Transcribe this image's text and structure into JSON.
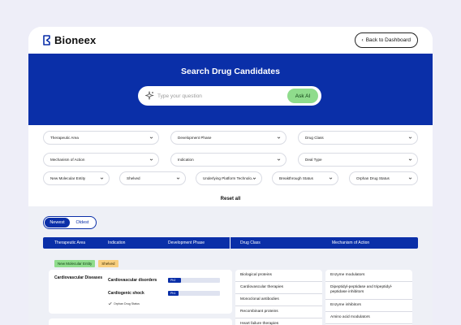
{
  "brand": {
    "name": "Bioneex"
  },
  "header": {
    "back_label": "Back to Dashboard"
  },
  "hero": {
    "title": "Search Drug Candidates"
  },
  "search": {
    "placeholder": "Type your question",
    "value": "",
    "ask_label": "Ask AI"
  },
  "filters": {
    "row1": [
      "Therapeutic Area",
      "Development Phase",
      "Drug Class"
    ],
    "row2": [
      "Mechanism of Action",
      "Indication",
      "Deal Type"
    ],
    "row3": [
      "New Molecular Entity",
      "Shelved",
      "Underlying Platform Technolo...",
      "Breakthrough Status",
      "Orphan Drug Status"
    ],
    "reset_label": "Reset all"
  },
  "sort": {
    "newest": "Newest",
    "oldest": "Oldest",
    "active": "Newest"
  },
  "table": {
    "columns": [
      "Therapeutic Area",
      "Indication",
      "Development Phase",
      "Drug Class",
      "Mechanism of Action"
    ]
  },
  "results": [
    {
      "tags": [
        "New Molecular Entity",
        "Shelved"
      ],
      "therapeutic_area": "Cardiovascular Diseases",
      "indications": [
        {
          "name": "Cardiovascular disorders",
          "phase": "Ph2",
          "progress": 0.25
        },
        {
          "name": "Cardiogenic shock",
          "phase": "Ph1",
          "progress": 0.2
        }
      ],
      "orphan_status": "Orphan Drug Status",
      "drug_classes": [
        "Biological proteins",
        "Cardiovascular therapies",
        "Monoclonal antibodies",
        "Recombinant proteins",
        "Heart failure therapies"
      ],
      "mechanisms": [
        "Enzyme modulators",
        "Dipeptidyl-peptidase and tripeptidyl-peptidase inhibitors",
        "Enzyme inhibitors",
        "Amino acid modulators"
      ]
    }
  ],
  "colors": {
    "primary": "#0a2fa8",
    "accent_green": "#8fdc8c",
    "shelved_tag": "#f8cf7f",
    "page_bg": "#eeeef8"
  }
}
